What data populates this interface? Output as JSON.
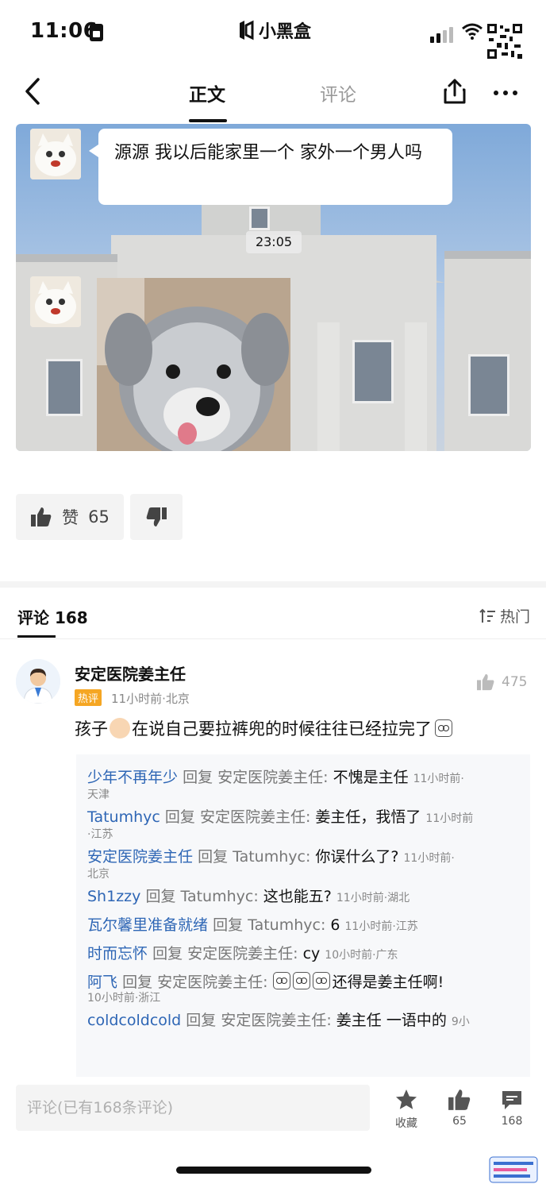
{
  "status_bar": {
    "time": "11:06",
    "app_name": "小黑盒"
  },
  "nav": {
    "tab_main": "正文",
    "tab_comments": "评论"
  },
  "post": {
    "message": "源源 我以后能家里一个 家外一个男人吗",
    "timestamp": "23:05"
  },
  "vote": {
    "like_label": "赞",
    "like_count": "65"
  },
  "comments_header": {
    "label": "评论",
    "count": "168",
    "sort_label": "热门"
  },
  "comment": {
    "user": "安定医院姜主任",
    "badge": "热评",
    "meta": "11小时前·北京",
    "likes": "475",
    "text_before": "孩子",
    "text_after": "在说自己要拉裤兜的时候往往已经拉完了"
  },
  "replies": [
    {
      "user": "少年不再年少",
      "verb": "回复",
      "target": "安定医院姜主任:",
      "text": "不愧是主任",
      "time": "11小时前·",
      "loc": "天津"
    },
    {
      "user": "Tatumhyc",
      "verb": "回复",
      "target": "安定医院姜主任:",
      "text": "姜主任，我悟了",
      "time": "11小时前",
      "loc": "·江苏"
    },
    {
      "user": "安定医院姜主任",
      "verb": "回复",
      "target": "Tatumhyc:",
      "text": "你误什么了?",
      "time": "11小时前·",
      "loc": "北京"
    },
    {
      "user": "Sh1zzy",
      "verb": "回复",
      "target": "Tatumhyc:",
      "text": "这也能五?",
      "time": "11小时前·湖北",
      "loc": ""
    },
    {
      "user": "瓦尔馨里准备就绪",
      "verb": "回复",
      "target": "Tatumhyc:",
      "text": "6",
      "time": "11小时前·江苏",
      "loc": ""
    },
    {
      "user": "时而忘怀",
      "verb": "回复",
      "target": "安定医院姜主任:",
      "text": "cy",
      "time": "10小时前·广东",
      "loc": ""
    },
    {
      "user": "阿飞",
      "verb": "回复",
      "target": "安定医院姜主任:",
      "text": "还得是姜主任啊!",
      "time": "",
      "loc": "10小时前·浙江"
    },
    {
      "user": "coldcoldcold",
      "verb": "回复",
      "target": "安定医院姜主任:",
      "text": "姜主任 一语中的",
      "time": "9小",
      "loc": ""
    }
  ],
  "bottom_bar": {
    "input_placeholder": "评论(已有168条评论)",
    "favorite_label": "收藏",
    "like_count": "65",
    "comment_count": "168"
  },
  "colors": {
    "link_blue": "#2e66b5",
    "badge_orange": "#f5a623"
  }
}
